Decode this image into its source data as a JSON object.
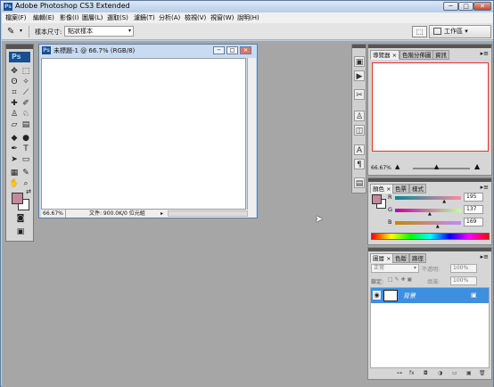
{
  "window": {
    "title": "Adobe Photoshop CS3 Extended",
    "app_badge": "Ps",
    "min_glyph": "─",
    "max_glyph": "□",
    "close_glyph": "✕"
  },
  "menu": {
    "items": [
      "檔案(F)",
      "編輯(E)",
      "影像(I)",
      "圖層(L)",
      "選取(S)",
      "濾鏡(T)",
      "分析(A)",
      "檢視(V)",
      "視窗(W)",
      "說明(H)"
    ]
  },
  "options": {
    "tool_icon": "eyedropper-icon",
    "tool_glyph": "✎",
    "arrow_glyph": "▾",
    "sample_size_label": "樣本尺寸:",
    "sample_size_value": "點狀樣本",
    "bridge_icon": "bridge-icon",
    "bridge_glyph": "⬚",
    "workspace_label": "工作區 ▾"
  },
  "toolbox": {
    "badge": "Ps",
    "tools": [
      {
        "name": "move",
        "glyph": "✥"
      },
      {
        "name": "marquee",
        "glyph": "⬚"
      },
      {
        "name": "lasso",
        "glyph": "ʘ"
      },
      {
        "name": "magic-wand",
        "glyph": "✧"
      },
      {
        "name": "crop",
        "glyph": "⌗"
      },
      {
        "name": "slice",
        "glyph": "⟋"
      },
      {
        "name": "healing",
        "glyph": "✚"
      },
      {
        "name": "brush",
        "glyph": "✐"
      },
      {
        "name": "stamp",
        "glyph": "♙"
      },
      {
        "name": "history-brush",
        "glyph": "♘"
      },
      {
        "name": "eraser",
        "glyph": "▱"
      },
      {
        "name": "gradient",
        "glyph": "▤"
      },
      {
        "name": "blur",
        "glyph": "◆"
      },
      {
        "name": "dodge",
        "glyph": "●"
      },
      {
        "name": "pen",
        "glyph": "✒"
      },
      {
        "name": "type",
        "glyph": "T"
      },
      {
        "name": "path-select",
        "glyph": "➤"
      },
      {
        "name": "shape",
        "glyph": "▭"
      },
      {
        "name": "notes",
        "glyph": "▦"
      },
      {
        "name": "eyedropper",
        "glyph": "✎"
      },
      {
        "name": "hand",
        "glyph": "✋"
      },
      {
        "name": "zoom",
        "glyph": "⌕"
      }
    ],
    "swap_glyph": "⇄",
    "quickmask_glyph": "◙",
    "screenmode_glyph": "▣",
    "fg_color": "#c3899e",
    "bg_color": "#ffffff"
  },
  "document": {
    "badge": "Ps",
    "title": "未標題-1 @ 66.7% (RGB/8)",
    "zoom": "66.67%",
    "info": "文件: 900.0K/0 位元組",
    "nav_glyph": "▸"
  },
  "dock": {
    "icons": [
      {
        "name": "navigator",
        "glyph": "▣"
      },
      {
        "name": "history",
        "glyph": "▶"
      },
      {
        "name": "tools",
        "glyph": "✂"
      },
      {
        "name": "stamp",
        "glyph": "♙"
      },
      {
        "name": "align",
        "glyph": "◫"
      },
      {
        "name": "character",
        "glyph": "A"
      },
      {
        "name": "paragraph",
        "glyph": "¶"
      },
      {
        "name": "layer-comp",
        "glyph": "▤"
      }
    ]
  },
  "navigator": {
    "tabs": [
      "導覽器 ×",
      "色階分佈圖",
      "資訊"
    ],
    "menu_glyph": "▸≡",
    "zoom": "66.67%",
    "zoom_out_glyph": "▲",
    "zoom_in_glyph": "▲",
    "zoom_thumb_glyph": "▲",
    "zoom_level": 0.42
  },
  "color": {
    "tabs": [
      "顏色 ×",
      "色票",
      "樣式"
    ],
    "menu_glyph": "▸≡",
    "fg": "#c3899e",
    "bg": "#ffffff",
    "channels": [
      {
        "label": "R",
        "value": "195",
        "gradient": "linear-gradient(to right, #00899e, #ff899e)",
        "level": 0.76
      },
      {
        "label": "G",
        "value": "137",
        "gradient": "linear-gradient(to right, #c3009e, #c3ff9e)",
        "level": 0.54
      },
      {
        "label": "B",
        "value": "169",
        "gradient": "linear-gradient(to right, #c38900, #c389ff)",
        "level": 0.66
      }
    ],
    "thumb_glyph": "▲"
  },
  "layers": {
    "tabs": [
      "圖層 ×",
      "色版",
      "路徑"
    ],
    "menu_glyph": "▸≡",
    "blend_mode": "正常",
    "opacity_label": "不透明:",
    "opacity_value": "100%",
    "lock_label": "鎖定:",
    "lock_icons": "□ ✎ ✚ ▣",
    "fill_label": "填滿:",
    "fill_value": "100%",
    "layer_name": "背景",
    "eye_glyph": "◉",
    "lock_glyph": "▣",
    "bottom_icons": [
      "⊶",
      "fx",
      "◘",
      "◑",
      "▭",
      "▣",
      "🗑"
    ]
  }
}
